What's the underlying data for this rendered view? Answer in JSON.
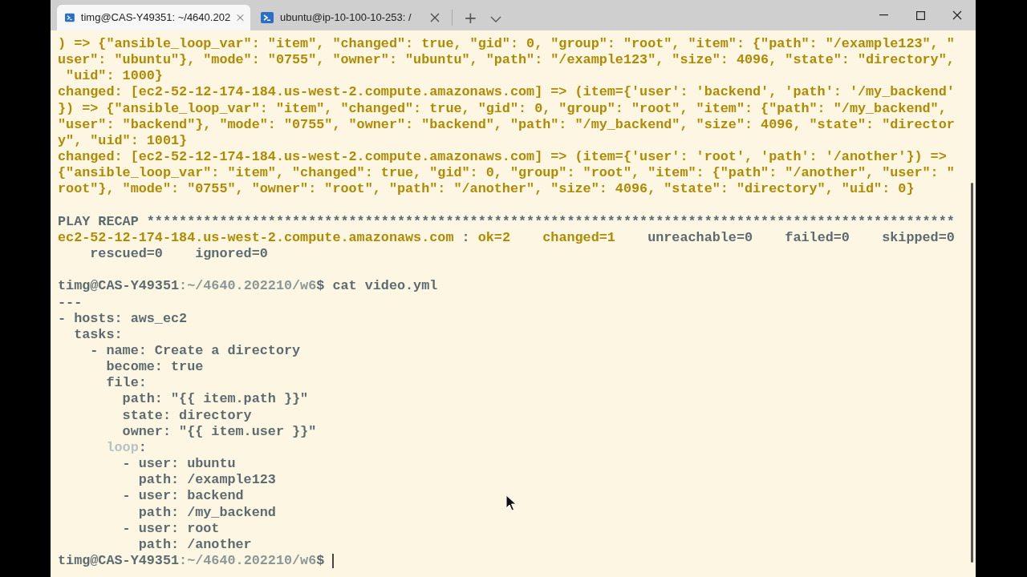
{
  "tabs": [
    {
      "title": "timg@CAS-Y49351: ~/4640.202",
      "selected": true
    },
    {
      "title": "ubuntu@ip-10-100-10-253: /",
      "selected": false
    }
  ],
  "new_tab_button": "+",
  "terminal": {
    "lines": [
      {
        "segments": [
          {
            "text": ") => {\"ansible_loop_var\": \"item\", \"changed\": true, \"gid\": 0, \"group\": \"root\", \"item\": {\"path\": \"/example123\", \"",
            "color": "#b08a00"
          }
        ]
      },
      {
        "segments": [
          {
            "text": "user\": \"ubuntu\"}, \"mode\": \"0755\", \"owner\": \"ubuntu\", \"path\": \"/example123\", \"size\": 4096, \"state\": \"directory\",",
            "color": "#b08a00"
          }
        ]
      },
      {
        "segments": [
          {
            "text": " \"uid\": 1000}",
            "color": "#b08a00"
          }
        ]
      },
      {
        "segments": [
          {
            "text": "changed: [ec2-52-12-174-184.us-west-2.compute.amazonaws.com] => (item={'user': 'backend', 'path': '/my_backend'",
            "color": "#b08a00"
          }
        ]
      },
      {
        "segments": [
          {
            "text": "}) => {\"ansible_loop_var\": \"item\", \"changed\": true, \"gid\": 0, \"group\": \"root\", \"item\": {\"path\": \"/my_backend\",",
            "color": "#b08a00"
          }
        ]
      },
      {
        "segments": [
          {
            "text": "\"user\": \"backend\"}, \"mode\": \"0755\", \"owner\": \"backend\", \"path\": \"/my_backend\", \"size\": 4096, \"state\": \"director",
            "color": "#b08a00"
          }
        ]
      },
      {
        "segments": [
          {
            "text": "y\", \"uid\": 1001}",
            "color": "#b08a00"
          }
        ]
      },
      {
        "segments": [
          {
            "text": "changed: [ec2-52-12-174-184.us-west-2.compute.amazonaws.com] => (item={'user': 'root', 'path': '/another'}) =>",
            "color": "#b08a00"
          }
        ]
      },
      {
        "segments": [
          {
            "text": "{\"ansible_loop_var\": \"item\", \"changed\": true, \"gid\": 0, \"group\": \"root\", \"item\": {\"path\": \"/another\", \"user\": \"",
            "color": "#b08a00"
          }
        ]
      },
      {
        "segments": [
          {
            "text": "root\"}, \"mode\": \"0755\", \"owner\": \"root\", \"path\": \"/another\", \"size\": 4096, \"state\": \"directory\", \"uid\": 0}",
            "color": "#b08a00"
          }
        ]
      },
      {
        "space_before": true,
        "segments": [
          {
            "text": "PLAY RECAP ****************************************************************************************************",
            "color": "#5c6b6f"
          }
        ]
      },
      {
        "segments": [
          {
            "text": "ec2-52-12-174-184.us-west-2.compute.amazonaws.com",
            "color": "#b08a00"
          },
          {
            "text": " : ",
            "color": "#5c6b6f"
          },
          {
            "text": "ok=2    changed=1",
            "color": "#b08a00"
          },
          {
            "text": "    unreachable=0    failed=0    skipped=0",
            "color": "#5c6b6f"
          }
        ]
      },
      {
        "segments": [
          {
            "text": "    rescued=0    ignored=0",
            "color": "#5c6b6f"
          }
        ]
      },
      {
        "space_before": true,
        "segments": [
          {
            "text": "timg@CAS-Y49351",
            "color": "#5c6b6f"
          },
          {
            "text": ":~/4640.202210/w6",
            "color": "#8a9797"
          },
          {
            "text": "$ cat video.yml",
            "color": "#5c6b6f"
          }
        ]
      },
      {
        "segments": [
          {
            "text": "---",
            "color": "#5c6b6f"
          }
        ]
      },
      {
        "segments": [
          {
            "text": "- hosts: aws_ec2",
            "color": "#5c6b6f"
          }
        ]
      },
      {
        "segments": [
          {
            "text": "  tasks:",
            "color": "#5c6b6f"
          }
        ]
      },
      {
        "segments": [
          {
            "text": "    - name: Create a directory",
            "color": "#5c6b6f"
          }
        ]
      },
      {
        "segments": [
          {
            "text": "      become: true",
            "color": "#5c6b6f"
          }
        ]
      },
      {
        "segments": [
          {
            "text": "      file:",
            "color": "#5c6b6f"
          }
        ]
      },
      {
        "segments": [
          {
            "text": "        path: \"{{ item.path }}\"",
            "color": "#5c6b6f"
          }
        ]
      },
      {
        "segments": [
          {
            "text": "        state: directory",
            "color": "#5c6b6f"
          }
        ]
      },
      {
        "segments": [
          {
            "text": "        owner: \"{{ item.user }}\"",
            "color": "#5c6b6f"
          }
        ]
      },
      {
        "segments": [
          {
            "text": "      loop",
            "color": "#b8c2c2"
          },
          {
            "text": ":",
            "color": "#5c6b6f"
          }
        ]
      },
      {
        "segments": [
          {
            "text": "        - user: ubuntu",
            "color": "#5c6b6f"
          }
        ]
      },
      {
        "segments": [
          {
            "text": "          path: /example123",
            "color": "#5c6b6f"
          }
        ]
      },
      {
        "segments": [
          {
            "text": "        - user: backend",
            "color": "#5c6b6f"
          }
        ]
      },
      {
        "segments": [
          {
            "text": "          path: /my_backend",
            "color": "#5c6b6f"
          }
        ]
      },
      {
        "segments": [
          {
            "text": "        - user: root",
            "color": "#5c6b6f"
          }
        ]
      },
      {
        "segments": [
          {
            "text": "          path: /another",
            "color": "#5c6b6f"
          }
        ]
      },
      {
        "segments": [
          {
            "text": "timg@CAS-Y49351",
            "color": "#5c6b6f"
          },
          {
            "text": ":~/4640.202210/w6",
            "color": "#8a9797"
          },
          {
            "text": "$ ",
            "color": "#5c6b6f"
          }
        ],
        "cursor": true
      }
    ]
  }
}
